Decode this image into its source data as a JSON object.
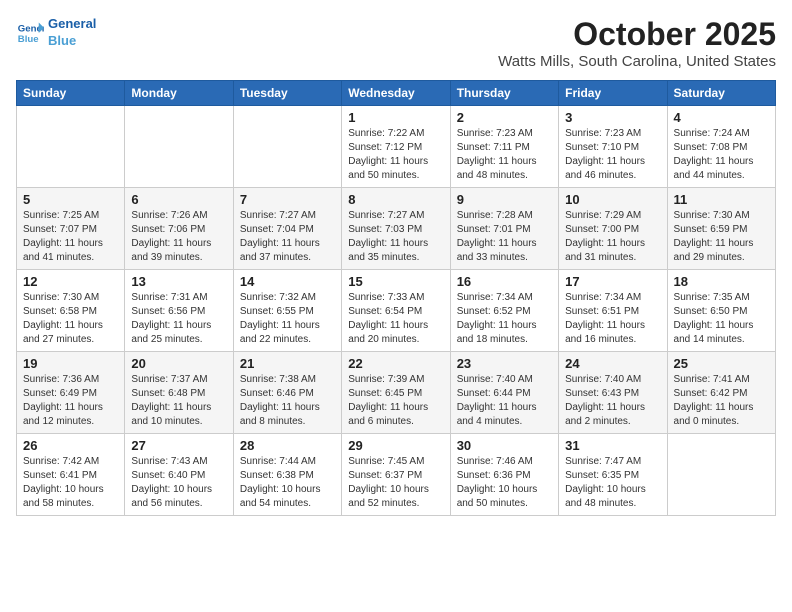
{
  "logo": {
    "line1": "General",
    "line2": "Blue"
  },
  "title": "October 2025",
  "location": "Watts Mills, South Carolina, United States",
  "days_of_week": [
    "Sunday",
    "Monday",
    "Tuesday",
    "Wednesday",
    "Thursday",
    "Friday",
    "Saturday"
  ],
  "weeks": [
    [
      {
        "day": "",
        "info": ""
      },
      {
        "day": "",
        "info": ""
      },
      {
        "day": "",
        "info": ""
      },
      {
        "day": "1",
        "info": "Sunrise: 7:22 AM\nSunset: 7:12 PM\nDaylight: 11 hours\nand 50 minutes."
      },
      {
        "day": "2",
        "info": "Sunrise: 7:23 AM\nSunset: 7:11 PM\nDaylight: 11 hours\nand 48 minutes."
      },
      {
        "day": "3",
        "info": "Sunrise: 7:23 AM\nSunset: 7:10 PM\nDaylight: 11 hours\nand 46 minutes."
      },
      {
        "day": "4",
        "info": "Sunrise: 7:24 AM\nSunset: 7:08 PM\nDaylight: 11 hours\nand 44 minutes."
      }
    ],
    [
      {
        "day": "5",
        "info": "Sunrise: 7:25 AM\nSunset: 7:07 PM\nDaylight: 11 hours\nand 41 minutes."
      },
      {
        "day": "6",
        "info": "Sunrise: 7:26 AM\nSunset: 7:06 PM\nDaylight: 11 hours\nand 39 minutes."
      },
      {
        "day": "7",
        "info": "Sunrise: 7:27 AM\nSunset: 7:04 PM\nDaylight: 11 hours\nand 37 minutes."
      },
      {
        "day": "8",
        "info": "Sunrise: 7:27 AM\nSunset: 7:03 PM\nDaylight: 11 hours\nand 35 minutes."
      },
      {
        "day": "9",
        "info": "Sunrise: 7:28 AM\nSunset: 7:01 PM\nDaylight: 11 hours\nand 33 minutes."
      },
      {
        "day": "10",
        "info": "Sunrise: 7:29 AM\nSunset: 7:00 PM\nDaylight: 11 hours\nand 31 minutes."
      },
      {
        "day": "11",
        "info": "Sunrise: 7:30 AM\nSunset: 6:59 PM\nDaylight: 11 hours\nand 29 minutes."
      }
    ],
    [
      {
        "day": "12",
        "info": "Sunrise: 7:30 AM\nSunset: 6:58 PM\nDaylight: 11 hours\nand 27 minutes."
      },
      {
        "day": "13",
        "info": "Sunrise: 7:31 AM\nSunset: 6:56 PM\nDaylight: 11 hours\nand 25 minutes."
      },
      {
        "day": "14",
        "info": "Sunrise: 7:32 AM\nSunset: 6:55 PM\nDaylight: 11 hours\nand 22 minutes."
      },
      {
        "day": "15",
        "info": "Sunrise: 7:33 AM\nSunset: 6:54 PM\nDaylight: 11 hours\nand 20 minutes."
      },
      {
        "day": "16",
        "info": "Sunrise: 7:34 AM\nSunset: 6:52 PM\nDaylight: 11 hours\nand 18 minutes."
      },
      {
        "day": "17",
        "info": "Sunrise: 7:34 AM\nSunset: 6:51 PM\nDaylight: 11 hours\nand 16 minutes."
      },
      {
        "day": "18",
        "info": "Sunrise: 7:35 AM\nSunset: 6:50 PM\nDaylight: 11 hours\nand 14 minutes."
      }
    ],
    [
      {
        "day": "19",
        "info": "Sunrise: 7:36 AM\nSunset: 6:49 PM\nDaylight: 11 hours\nand 12 minutes."
      },
      {
        "day": "20",
        "info": "Sunrise: 7:37 AM\nSunset: 6:48 PM\nDaylight: 11 hours\nand 10 minutes."
      },
      {
        "day": "21",
        "info": "Sunrise: 7:38 AM\nSunset: 6:46 PM\nDaylight: 11 hours\nand 8 minutes."
      },
      {
        "day": "22",
        "info": "Sunrise: 7:39 AM\nSunset: 6:45 PM\nDaylight: 11 hours\nand 6 minutes."
      },
      {
        "day": "23",
        "info": "Sunrise: 7:40 AM\nSunset: 6:44 PM\nDaylight: 11 hours\nand 4 minutes."
      },
      {
        "day": "24",
        "info": "Sunrise: 7:40 AM\nSunset: 6:43 PM\nDaylight: 11 hours\nand 2 minutes."
      },
      {
        "day": "25",
        "info": "Sunrise: 7:41 AM\nSunset: 6:42 PM\nDaylight: 11 hours\nand 0 minutes."
      }
    ],
    [
      {
        "day": "26",
        "info": "Sunrise: 7:42 AM\nSunset: 6:41 PM\nDaylight: 10 hours\nand 58 minutes."
      },
      {
        "day": "27",
        "info": "Sunrise: 7:43 AM\nSunset: 6:40 PM\nDaylight: 10 hours\nand 56 minutes."
      },
      {
        "day": "28",
        "info": "Sunrise: 7:44 AM\nSunset: 6:38 PM\nDaylight: 10 hours\nand 54 minutes."
      },
      {
        "day": "29",
        "info": "Sunrise: 7:45 AM\nSunset: 6:37 PM\nDaylight: 10 hours\nand 52 minutes."
      },
      {
        "day": "30",
        "info": "Sunrise: 7:46 AM\nSunset: 6:36 PM\nDaylight: 10 hours\nand 50 minutes."
      },
      {
        "day": "31",
        "info": "Sunrise: 7:47 AM\nSunset: 6:35 PM\nDaylight: 10 hours\nand 48 minutes."
      },
      {
        "day": "",
        "info": ""
      }
    ]
  ]
}
